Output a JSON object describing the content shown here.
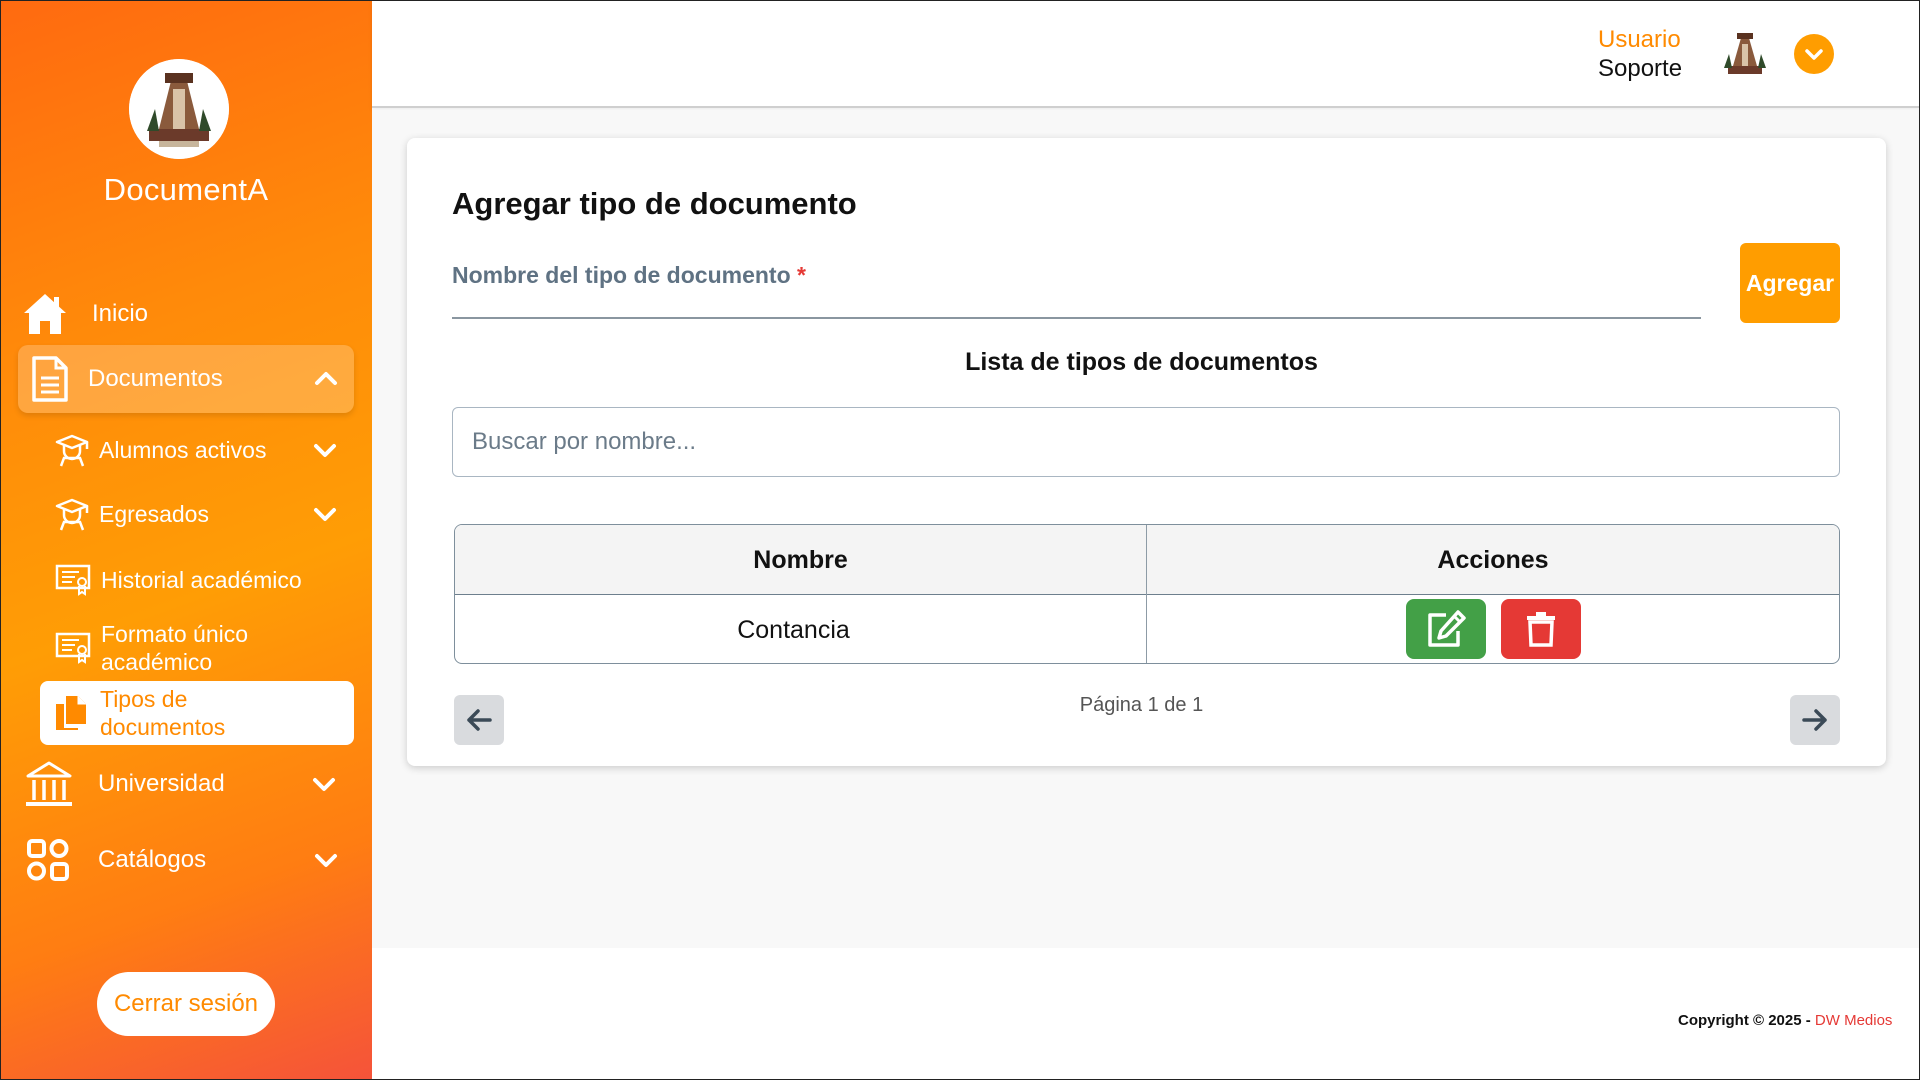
{
  "app": {
    "name": "DocumentA"
  },
  "colors": {
    "accent": "#ff9d00",
    "edit": "#43a047",
    "delete": "#e53935",
    "sidebar_start": "#ff6a10",
    "sidebar_end": "#f5533a"
  },
  "sidebar": {
    "items": [
      {
        "label": "Inicio",
        "icon": "home-icon"
      },
      {
        "label": "Documentos",
        "icon": "document-icon",
        "expanded": true
      },
      {
        "label": "Alumnos activos",
        "icon": "graduate-icon"
      },
      {
        "label": "Egresados",
        "icon": "graduate-icon"
      },
      {
        "label": "Historial académico",
        "icon": "certificate-icon"
      },
      {
        "label": "Formato único académico",
        "icon": "certificate-icon"
      },
      {
        "label": "Tipos de documentos",
        "icon": "documents-copy-icon",
        "active": true
      },
      {
        "label": "Universidad",
        "icon": "university-icon"
      },
      {
        "label": "Catálogos",
        "icon": "grid-icon"
      }
    ],
    "logout_label": "Cerrar sesión"
  },
  "header": {
    "user_role": "Usuario",
    "user_name": "Soporte"
  },
  "form": {
    "title": "Agregar tipo de documento",
    "field_label": "Nombre del tipo de documento",
    "required_mark": "*",
    "add_label": "Agregar"
  },
  "list": {
    "title": "Lista de tipos de documentos",
    "search_placeholder": "Buscar por nombre...",
    "columns": [
      "Nombre",
      "Acciones"
    ],
    "rows": [
      {
        "name": "Contancia"
      }
    ],
    "pagination": "Página 1 de 1"
  },
  "footer": {
    "copyright": "Copyright © 2025 - ",
    "brand": "DW Medios"
  }
}
